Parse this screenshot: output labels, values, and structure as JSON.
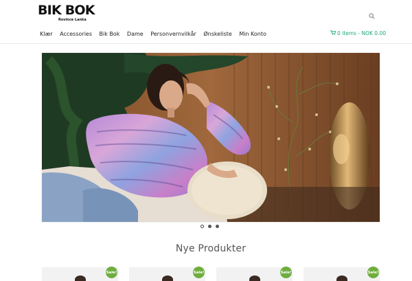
{
  "brand": {
    "name": "BIK BOK",
    "tagline": "Rovince Lanka"
  },
  "nav": {
    "items": [
      "Klær",
      "Accessories",
      "Bik Bok",
      "Dame",
      "Personvernvilkår",
      "Ønskeliste",
      "Min Konto"
    ]
  },
  "cart": {
    "label": "0 items - NOK 0.00"
  },
  "hero": {
    "image": "model-in-striped-knit-sweater",
    "slides": 3,
    "active_slide": 1
  },
  "products_section": {
    "title": "Nye Produkter"
  },
  "products": [
    {
      "badge": "Sale!"
    },
    {
      "badge": "Sale!"
    },
    {
      "badge": "Sale!"
    },
    {
      "badge": "Sale!"
    }
  ],
  "colors": {
    "accent": "#1aa77c",
    "sale_badge": "#6fae3e"
  },
  "icons": {
    "search": "search-icon",
    "cart": "cart-icon"
  }
}
